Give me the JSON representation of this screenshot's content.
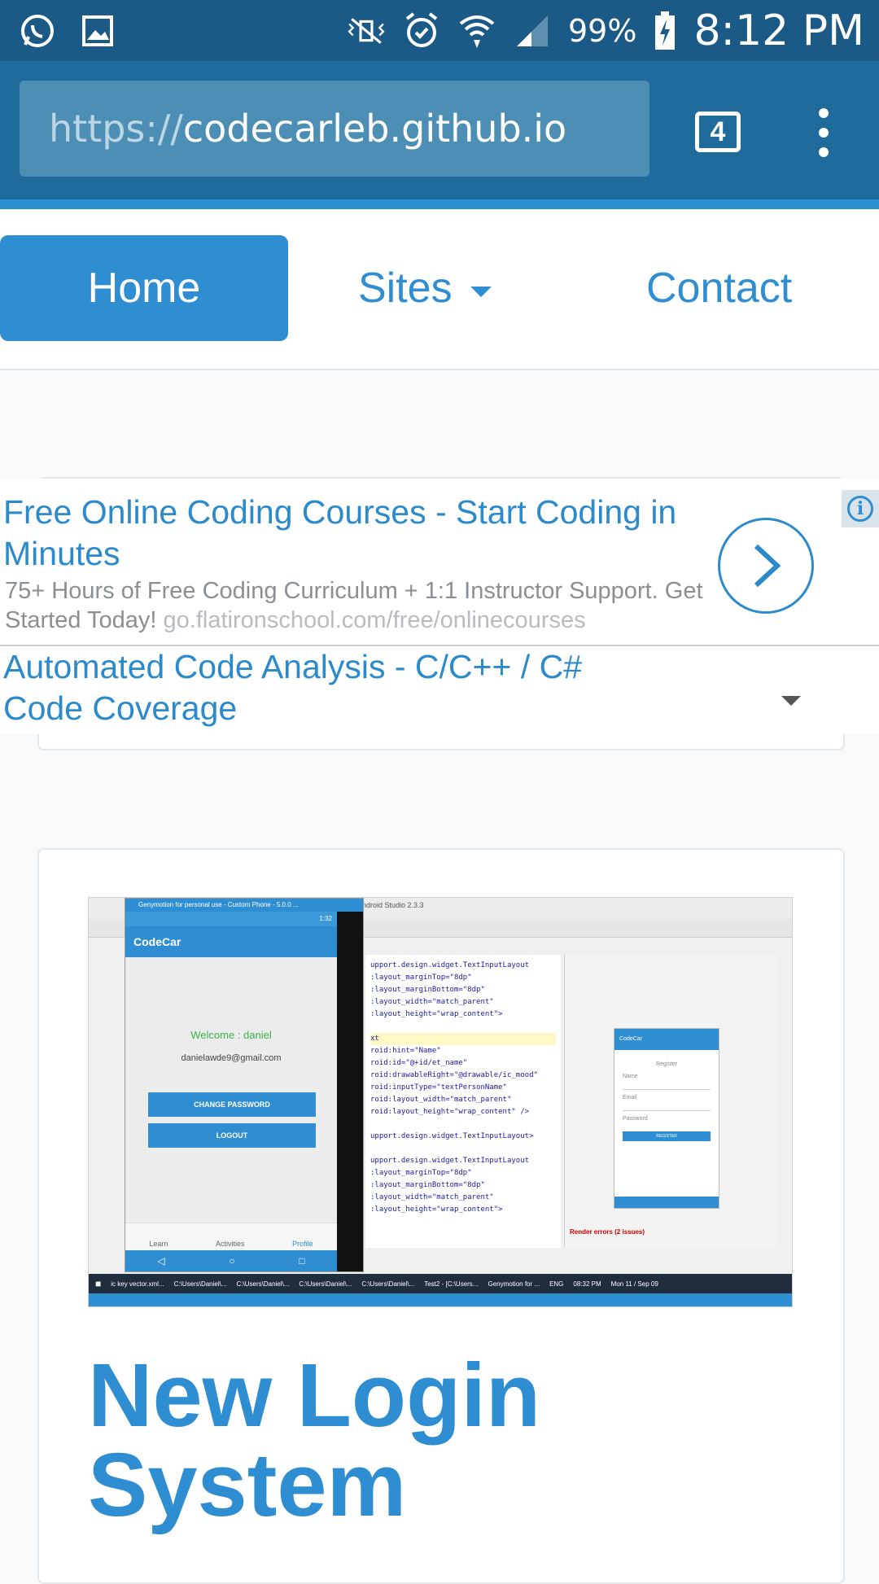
{
  "status_bar": {
    "icons_left": [
      "whatsapp-icon",
      "gallery-icon"
    ],
    "icons_right": [
      "vibrate-icon",
      "alarm-icon",
      "wifi-icon",
      "signal-icon"
    ],
    "battery": "99%",
    "time": "8:12 PM"
  },
  "browser": {
    "url_scheme": "https://",
    "url_host": "codecarleb.github.io",
    "tab_count": "4"
  },
  "nav": {
    "home": "Home",
    "sites": "Sites",
    "contact": "Contact"
  },
  "ads": {
    "ad1_title": "Free Online Coding Courses - Start Coding in Minutes",
    "ad1_desc": "75+ Hours of Free Coding Curriculum + 1:1 Instructor Support. Get Started Today!",
    "ad1_url": "go.flatironschool.com/free/onlinecourses",
    "ad2_title": "Automated Code Analysis - C/C++ / C# Code Coverage",
    "info_icon": "i"
  },
  "article": {
    "title": "New Login System",
    "screenshot": {
      "window_title": "Genymotion for personal use - Custom Phone - 5.0.0 ...",
      "ide_title": "Android Studio 2.3.3",
      "emu_time": "1:32",
      "app_name": "CodeCar",
      "welcome": "Welcome : daniel",
      "email": "danielawde9@gmail.com",
      "change_password": "CHANGE PASSWORD",
      "logout": "LOGOUT",
      "tabs": [
        "Learn",
        "Activities",
        "Profile"
      ],
      "code_lines": [
        "upport.design.widget.TextInputLayout",
        ":layout_marginTop=\"8dp\"",
        ":layout_marginBottom=\"8dp\"",
        ":layout_width=\"match_parent\"",
        ":layout_height=\"wrap_content\">",
        "",
        "xt",
        "roid:hint=\"Name\"",
        "roid:id=\"@+id/et_name\"",
        "roid:drawableRight=\"@drawable/ic_mood\"",
        "roid:inputType=\"textPersonName\"",
        "roid:layout_width=\"match_parent\"",
        "roid:layout_height=\"wrap_content\" />",
        "",
        "upport.design.widget.TextInputLayout>",
        "",
        "upport.design.widget.TextInputLayout",
        ":layout_marginTop=\"8dp\"",
        ":layout_marginBottom=\"8dp\"",
        ":layout_width=\"match_parent\"",
        ":layout_height=\"wrap_content\">"
      ],
      "preview_app": "CodeCar",
      "preview_register": "Register",
      "preview_name": "Name",
      "preview_email": "Email",
      "preview_password": "Password",
      "preview_btn": "REGISTER",
      "render_errors": "Render errors (2 issues)",
      "taskbar_items": [
        "ic key vector.xml...",
        "C:\\Users\\Daniel\\...",
        "C:\\Users\\Daniel\\...",
        "C:\\Users\\Daniel\\...",
        "C:\\Users\\Daniel\\...",
        "Test2 - [C:\\Users...",
        "Genymotion for ..."
      ],
      "taskbar_time": "08:32 PM",
      "taskbar_date": "Mon 11 / Sep 09",
      "lang": "ENG"
    }
  },
  "colors": {
    "status_bar": "#1b5a86",
    "browser_bar": "#1f6b9b",
    "accent": "#2f8ed2"
  }
}
